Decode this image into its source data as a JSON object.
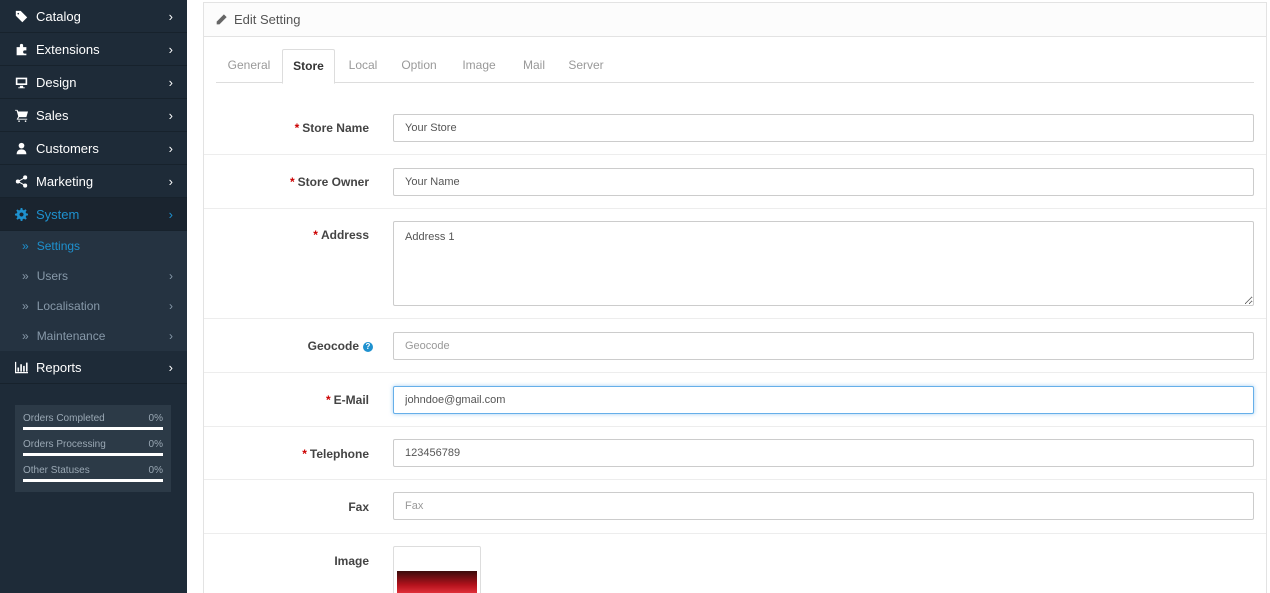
{
  "sidebar": {
    "items": [
      {
        "label": "Catalog",
        "icon": "tags-icon"
      },
      {
        "label": "Extensions",
        "icon": "puzzle-icon"
      },
      {
        "label": "Design",
        "icon": "monitor-icon"
      },
      {
        "label": "Sales",
        "icon": "cart-icon"
      },
      {
        "label": "Customers",
        "icon": "user-icon"
      },
      {
        "label": "Marketing",
        "icon": "share-icon"
      },
      {
        "label": "System",
        "icon": "gear-icon"
      },
      {
        "label": "Reports",
        "icon": "bar-chart-icon"
      }
    ],
    "system_sub": [
      {
        "label": "Settings"
      },
      {
        "label": "Users"
      },
      {
        "label": "Localisation"
      },
      {
        "label": "Maintenance"
      }
    ],
    "chevron": "›",
    "bullet": "»",
    "stats": [
      {
        "label": "Orders Completed",
        "percent": "0%",
        "value": 0
      },
      {
        "label": "Orders Processing",
        "percent": "0%",
        "value": 0
      },
      {
        "label": "Other Statuses",
        "percent": "0%",
        "value": 0
      }
    ]
  },
  "panel": {
    "title": "Edit Setting",
    "tabs": [
      "General",
      "Store",
      "Local",
      "Option",
      "Image",
      "Mail",
      "Server"
    ],
    "active_tab": "Store"
  },
  "form": {
    "required_mark": "*",
    "store_name": {
      "label": "Store Name",
      "value": "Your Store"
    },
    "store_owner": {
      "label": "Store Owner",
      "value": "Your Name"
    },
    "address": {
      "label": "Address",
      "value": "Address 1"
    },
    "geocode": {
      "label": "Geocode",
      "placeholder": "Geocode",
      "help": "?"
    },
    "email": {
      "label": "E-Mail",
      "value": "johndoe@gmail.com"
    },
    "telephone": {
      "label": "Telephone",
      "value": "123456789"
    },
    "fax": {
      "label": "Fax",
      "placeholder": "Fax"
    },
    "image": {
      "label": "Image"
    }
  },
  "colors": {
    "sidebar_bg": "#1e2b38",
    "accent": "#1e91cf",
    "required": "#cc0000"
  }
}
